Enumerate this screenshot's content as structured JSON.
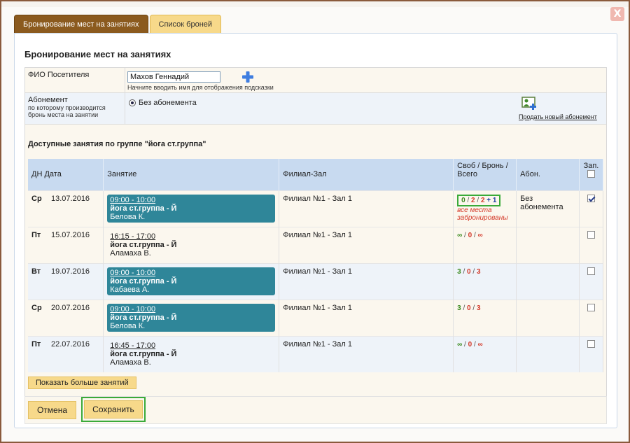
{
  "tabs": [
    {
      "label": "Бронирование мест на занятиях",
      "active": true
    },
    {
      "label": "Список броней",
      "active": false
    }
  ],
  "close_label": "X",
  "title": "Бронирование мест на занятиях",
  "visitor": {
    "label": "ФИО Посетителя",
    "value": "Махов Геннадий",
    "hint": "Начните вводить имя для отображения подсказки"
  },
  "subscription": {
    "label": "Абонемент",
    "sublabel": "по которому производится бронь места на занятии",
    "option": "Без абонемента",
    "sell_link": "Продать новый абонемент"
  },
  "available_title": "Доступные занятия по группе \"йога ст.группа\"",
  "table": {
    "headers": {
      "date": "ДН Дата",
      "lesson": "Занятие",
      "branch": "Филиал-Зал",
      "stats": "Своб / Бронь / Всего",
      "abon": "Абон.",
      "book": "Зап."
    },
    "rows": [
      {
        "day": "Ср",
        "date": "13.07.2016",
        "time": "09:00 - 10:00",
        "name": "йога ст.группа - Й",
        "teacher": "Белова К.",
        "branch": "Филиал №1 - Зал 1",
        "free": "0",
        "booked": "2",
        "total": "2",
        "extra": "+ 1",
        "note": "все места забронированы",
        "abon": "Без абонемента",
        "checked": true,
        "highlight": true
      },
      {
        "day": "Пт",
        "date": "15.07.2016",
        "time": "16:15 - 17:00",
        "name": "йога ст.группа - Й",
        "teacher": "Аламаха В.",
        "branch": "Филиал №1 - Зал 1",
        "free": "∞",
        "booked": "0",
        "total": "∞",
        "extra": "",
        "note": "",
        "abon": "",
        "checked": false,
        "highlight": false
      },
      {
        "day": "Вт",
        "date": "19.07.2016",
        "time": "09:00 - 10:00",
        "name": "йога ст.группа - Й",
        "teacher": "Кабаева А.",
        "branch": "Филиал №1 - Зал 1",
        "free": "3",
        "booked": "0",
        "total": "3",
        "extra": "",
        "note": "",
        "abon": "",
        "checked": false,
        "highlight": true
      },
      {
        "day": "Ср",
        "date": "20.07.2016",
        "time": "09:00 - 10:00",
        "name": "йога ст.группа - Й",
        "teacher": "Белова К.",
        "branch": "Филиал №1 - Зал 1",
        "free": "3",
        "booked": "0",
        "total": "3",
        "extra": "",
        "note": "",
        "abon": "",
        "checked": false,
        "highlight": true
      },
      {
        "day": "Пт",
        "date": "22.07.2016",
        "time": "16:45 - 17:00",
        "name": "йога ст.группа - Й",
        "teacher": "Аламаха В.",
        "branch": "Филиал №1 - Зал 1",
        "free": "∞",
        "booked": "0",
        "total": "∞",
        "extra": "",
        "note": "",
        "abon": "",
        "checked": false,
        "highlight": false
      }
    ]
  },
  "more_button": "Показать больше занятий",
  "cancel_button": "Отмена",
  "save_button": "Сохранить",
  "colors": {
    "accent_brown": "#8b5a1e",
    "tab_yellow": "#f7d98a",
    "lesson_teal": "#2f8699",
    "highlight_green": "#3aaa3a"
  },
  "icons": {
    "add_visitor": "plus-icon",
    "add_subscription": "add-subscription-icon",
    "close": "close-icon"
  }
}
